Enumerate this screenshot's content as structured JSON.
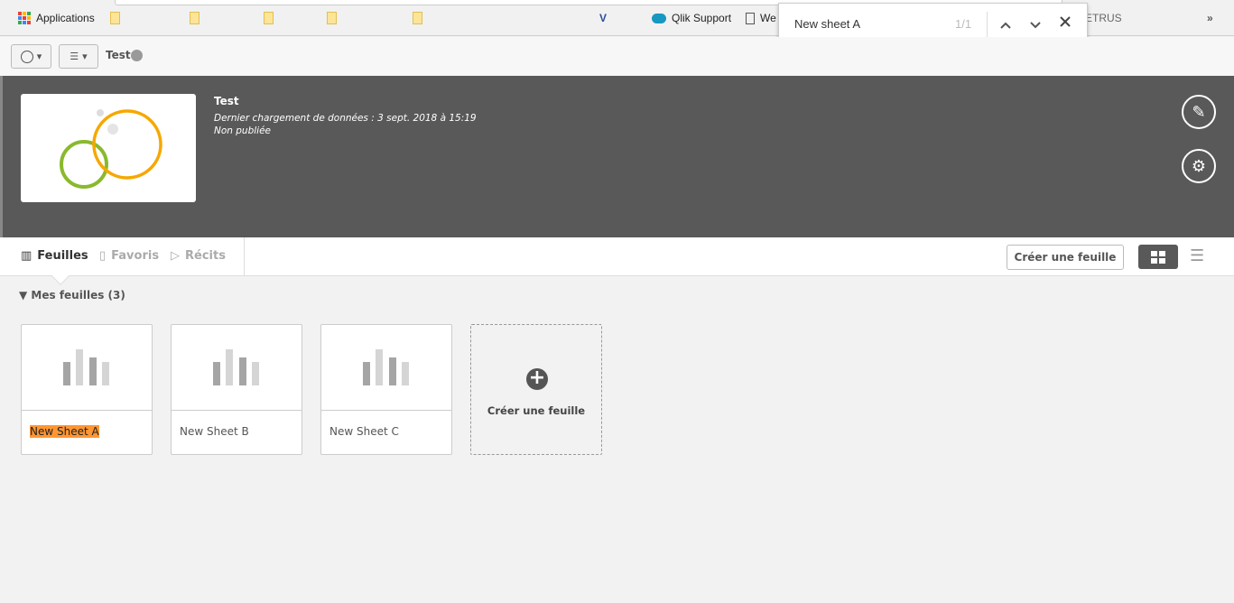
{
  "bookmarks": {
    "apps_label": "Applications",
    "qlik_support": "Qlik Support",
    "partial_we": "We",
    "partial_etrus": "ETRUS",
    "overflow": "»"
  },
  "find": {
    "query": "New sheet A",
    "count": "1/1",
    "prev": "⌃",
    "next": "⌄",
    "close": "✕"
  },
  "toolbar": {
    "app_name": "Test"
  },
  "app": {
    "title": "Test",
    "last_reload": "Dernier chargement de données : 3 sept. 2018 à 15:19",
    "status": "Non publiée"
  },
  "nav": {
    "tabs": [
      {
        "label": "Feuilles",
        "active": true
      },
      {
        "label": "Favoris"
      },
      {
        "label": "Récits"
      }
    ],
    "create_sheet": "Créer une feuille",
    "view": "grid"
  },
  "section": {
    "title": "Mes feuilles (3)"
  },
  "sheets": [
    {
      "name": "New Sheet A",
      "highlighted": true
    },
    {
      "name": "New Sheet B"
    },
    {
      "name": "New Sheet C"
    }
  ],
  "create_card": {
    "label": "Créer une feuille"
  },
  "colors": {
    "highlight": "#ff9632",
    "header": "#595959"
  }
}
